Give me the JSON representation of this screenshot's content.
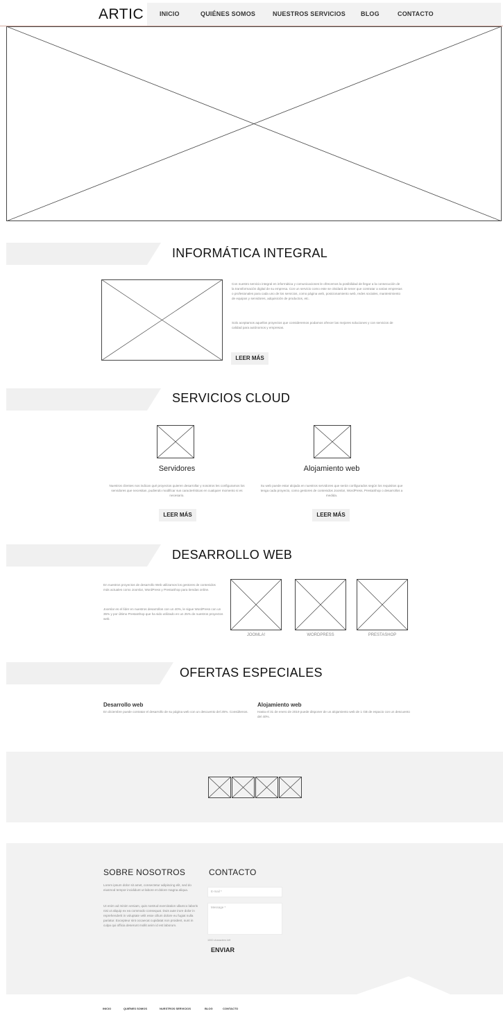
{
  "header": {
    "logo": "ARTIC",
    "nav": [
      "INICIO",
      "QUIÉNES SOMOS",
      "NUESTROS SERVICIOS",
      "BLOG",
      "CONTACTO"
    ]
  },
  "informatica": {
    "title": "INFORMÁTICA INTEGRAL",
    "paragraph1": "Con nuestro servicio integral en informática y comunicaciones le ofrecemos la posibilidad de llegar a la consecución de la transformación digital de su empresa. Con un servicio como este se olvidará de tener que contratar a varias empresas o profesionales para cada uno de los servicios, como página web, posicionamiento web, redes sociales, mantenimiento de equipos y servidores, adquisición de productos, etc.",
    "paragraph2": "Solo aceptamos aquellos proyectos que consideremos podamos ofrecer las mejores soluciones y con servicios de calidad para autónomos y empresas.",
    "button": "LEER MÁS"
  },
  "cloud": {
    "title": "SERVICIOS CLOUD",
    "items": [
      {
        "title": "Servidores",
        "text": "Nuestros clientes nos indican qué proyectos quieren desarrollar y nosotros les configuramos los servidores que necesitan, pudiendo modificar sus características en cualquier momento si es necesario.",
        "button": "LEER MÁS"
      },
      {
        "title": "Alojamiento web",
        "text": "Su web puede estar alojada en nuestros servidores que serán configurados según los requisitos que tenga cada proyecto, como gestores de contenidos Joomla!, WordPress, PrestaShop o desarrollos a medida.",
        "button": "LEER MÁS"
      }
    ]
  },
  "desarrollo": {
    "title": "DESARROLLO WEB",
    "paragraph1": "En nuestros proyectos de desarrollo Web utilizamos los gestores de contenidos más actuales como Joomla!, WordPress y PrestaShop para tiendas online.",
    "paragraph2": "Joomla! es el líder en nuestros desarrollos con un 40%, le sigue WordPress con un 35% y por último PrestaShop que ha sido utilizado en un 25% de nuestros proyectos web.",
    "cms": [
      "JOOMLA!",
      "WORDPRESS",
      "PRESTASHOP"
    ]
  },
  "ofertas": {
    "title": "OFERTAS ESPECIALES",
    "items": [
      {
        "title": "Desarrollo web",
        "text": "En diciembre puede contratar el desarrollo de su página web con un descuento del 25%. Consúltenos."
      },
      {
        "title": "Alojamiento web",
        "text": "Hasta el 31 de enero de 2019 puede disponer de un alojamiento web de 1 GB de espacio con un descuento del 40%."
      }
    ]
  },
  "footer": {
    "about_title": "SOBRE NOSOTROS",
    "about_p1": "Lorem ipsum dolor sit amet, consectetur adipiscing elit, sed do eiusmod tempor incididunt ut labore et dolore magna aliqua.",
    "about_p2": "Ut enim ad minim veniam, quis nostrud exercitation ullamco laboris nisi ut aliquip ex ea commodo consequat. Duis aute irure dolor in reprehenderit in voluptate velit esse cillum dolore eu fugiat nulla pariatur. Excepteur sint occaecat cupidatat non proident, sunt in culpa qui officia deserunt mollit anim id est laborum.",
    "contact_title": "CONTACTO",
    "email_placeholder": "E-mail *",
    "message_placeholder": "Message *",
    "chars_left": "1000 characters left",
    "send": "ENVIAR"
  },
  "bottom_nav": [
    "INICIO",
    "QUIÉNES SOMOS",
    "NUESTROS SERVICIOS",
    "BLOG",
    "CONTACTO"
  ]
}
